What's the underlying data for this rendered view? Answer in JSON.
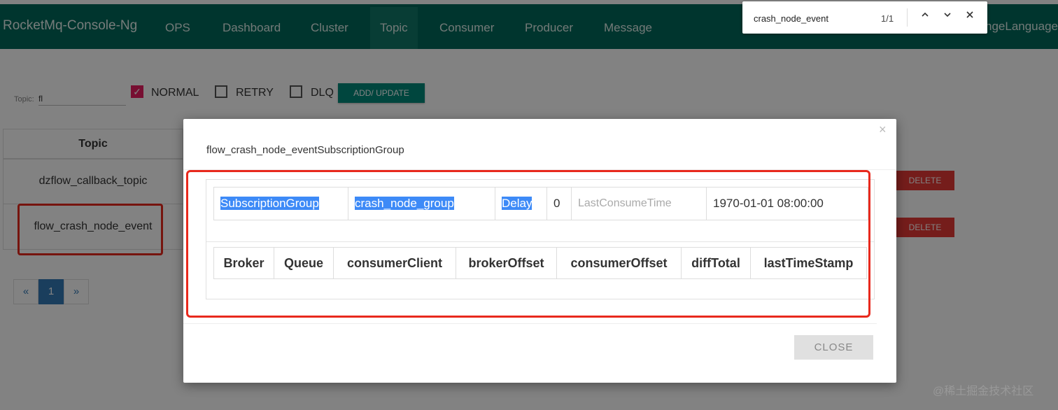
{
  "nav": {
    "brand": "RocketMq-Console-Ng",
    "items": [
      {
        "label": "OPS"
      },
      {
        "label": "Dashboard"
      },
      {
        "label": "Cluster"
      },
      {
        "label": "Topic"
      },
      {
        "label": "Consumer"
      },
      {
        "label": "Producer"
      },
      {
        "label": "Message"
      }
    ],
    "language": "ngeLanguage"
  },
  "find_bar": {
    "query": "crash_node_event",
    "count": "1/1",
    "icons": [
      "chevron-up-icon",
      "chevron-down-icon",
      "close-icon"
    ]
  },
  "filters": {
    "topic_label": "Topic:",
    "topic_value": "fl",
    "normal": {
      "label": "NORMAL",
      "checked": true
    },
    "retry": {
      "label": "RETRY",
      "checked": false
    },
    "dlq": {
      "label": "DLQ",
      "checked": false
    },
    "add_update_label": "ADD/ UPDATE"
  },
  "topic_table": {
    "header": "Topic",
    "rows": [
      {
        "name": "dzflow_callback_topic",
        "delete_label": "DELETE"
      },
      {
        "name": "flow_crash_node_event",
        "delete_label": "DELETE"
      }
    ]
  },
  "pagination": {
    "prev": "«",
    "current": "1",
    "next": "»"
  },
  "modal": {
    "title": "flow_crash_node_eventSubscriptionGroup",
    "close_x": "×",
    "subscription": {
      "label": "SubscriptionGroup",
      "group": "crash_node_group",
      "delay_label": "Delay",
      "delay_value": "0",
      "last_consume_label": "LastConsumeTime",
      "last_consume_value": "1970-01-01 08:00:00"
    },
    "columns": [
      "Broker",
      "Queue",
      "consumerClient",
      "brokerOffset",
      "consumerOffset",
      "diffTotal",
      "lastTimeStamp"
    ],
    "close_label": "CLOSE"
  },
  "watermark": "@稀土掘金技术社区",
  "colors": {
    "primary": "#00685a",
    "accent": "#e91e63",
    "danger": "#e53935",
    "highlight": "#3d8af7",
    "annotation": "#e8291d"
  }
}
